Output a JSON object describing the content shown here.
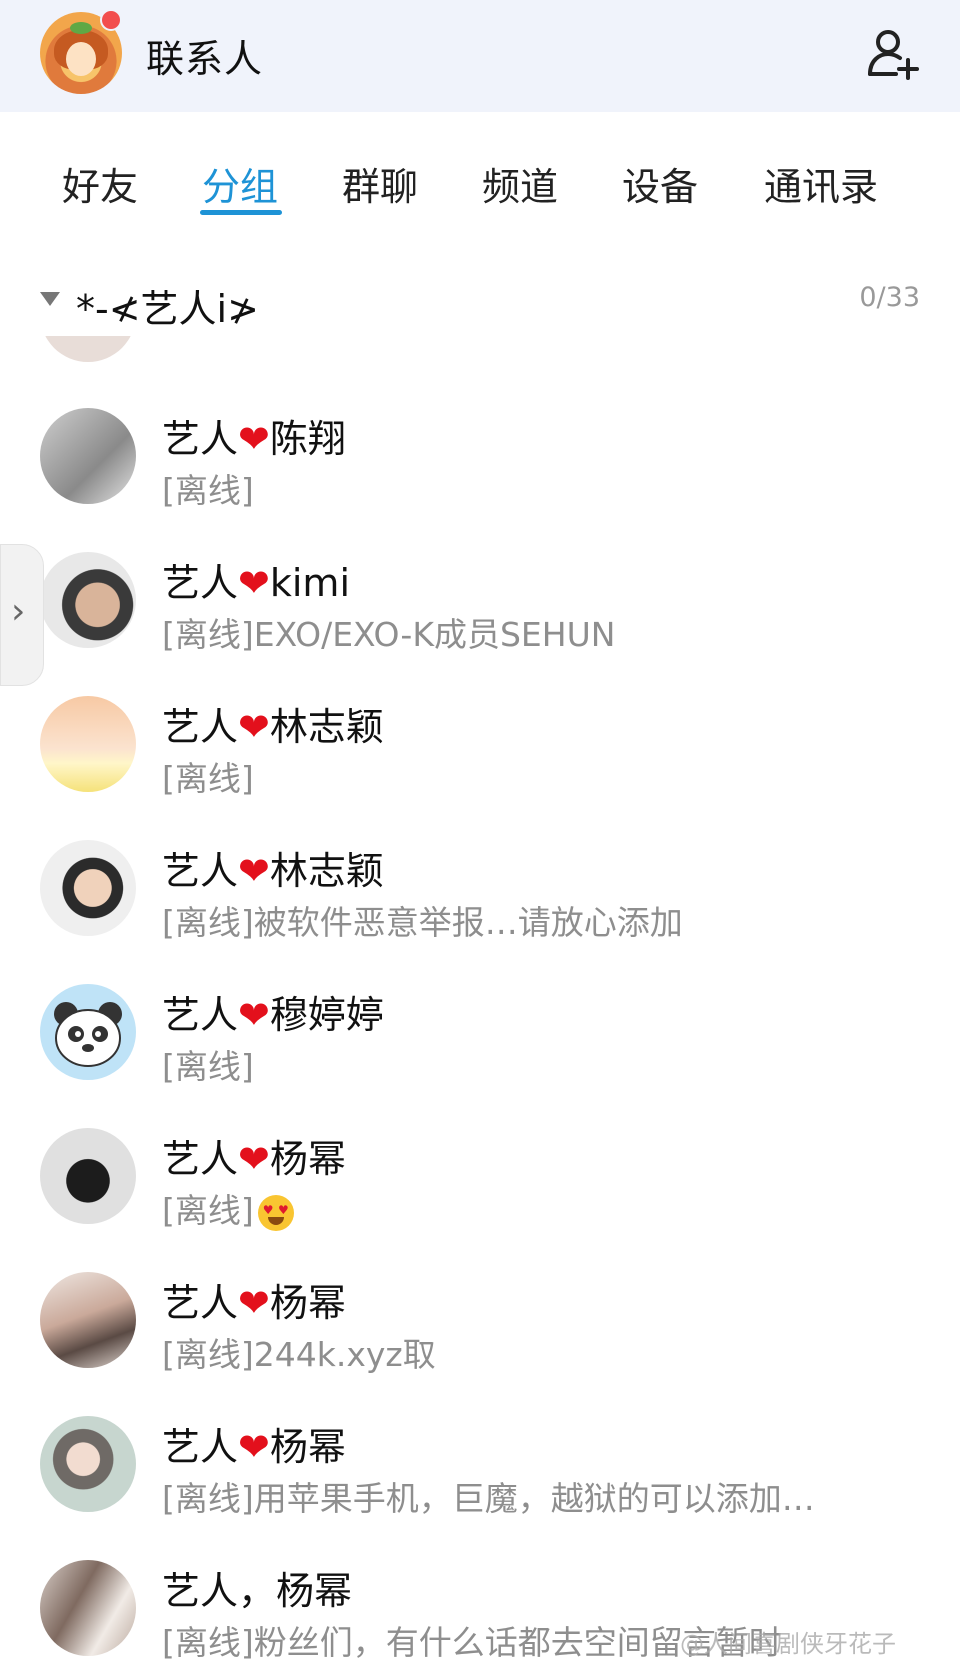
{
  "header": {
    "title": "联系人",
    "add_icon": "add-contact-icon"
  },
  "tabs": [
    {
      "label": "好友"
    },
    {
      "label": "分组",
      "active": true
    },
    {
      "label": "群聊"
    },
    {
      "label": "频道"
    },
    {
      "label": "设备"
    },
    {
      "label": "通讯录"
    }
  ],
  "group": {
    "name": "*-≮艺人i≯",
    "count": "0/33"
  },
  "contacts": [
    {
      "prefix": "艺人",
      "heart": "❤",
      "suffix": "陈翔",
      "status": "[离线]"
    },
    {
      "prefix": "艺人",
      "heart": "❤",
      "suffix": "kimi",
      "status": "[离线]EXO/EXO-K成员SEHUN"
    },
    {
      "prefix": "艺人",
      "heart": "❤",
      "suffix": "林志颖",
      "status": "[离线]"
    },
    {
      "prefix": "艺人",
      "heart": "❤",
      "suffix": "林志颖",
      "status": "[离线]被软件恶意举报…请放心添加"
    },
    {
      "prefix": "艺人",
      "heart": "❤",
      "suffix": "穆婷婷",
      "status": "[离线]"
    },
    {
      "prefix": "艺人",
      "heart": "❤",
      "suffix": "杨幂",
      "status": "[离线]"
    },
    {
      "prefix": "艺人",
      "heart": "❤",
      "suffix": "杨幂",
      "status": "[离线]244k.xyz取"
    },
    {
      "prefix": "艺人",
      "heart": "❤",
      "suffix": "杨幂",
      "status": "[离线]用苹果手机，巨魔，越狱的可以添加…"
    },
    {
      "prefix": "艺人，杨幂",
      "heart": "",
      "suffix": "",
      "status": "[离线]粉丝们，有什么话都去空间留言暂时"
    }
  ],
  "watermark": "@人间喜剧侠牙花子"
}
